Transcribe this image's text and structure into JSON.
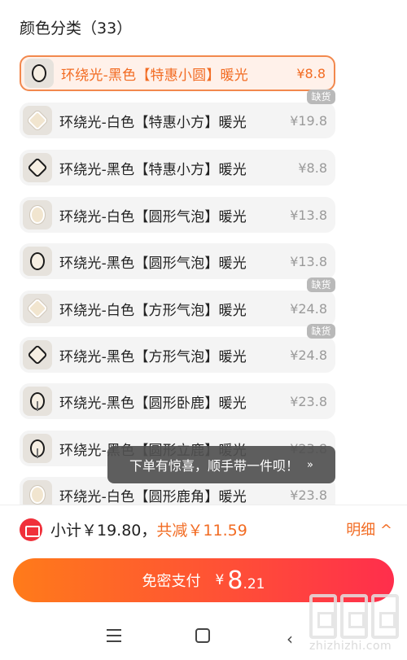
{
  "section": {
    "title": "颜色分类（33）"
  },
  "options": [
    {
      "label": "环绕光-黑色【特惠小圆】暖光",
      "price": "¥8.8",
      "badge": "",
      "selected": true
    },
    {
      "label": "环绕光-白色【特惠小方】暖光",
      "price": "¥19.8",
      "badge": "缺货",
      "selected": false
    },
    {
      "label": "环绕光-黑色【特惠小方】暖光",
      "price": "¥8.8",
      "badge": "",
      "selected": false
    },
    {
      "label": "环绕光-白色【圆形气泡】暖光",
      "price": "¥13.8",
      "badge": "",
      "selected": false
    },
    {
      "label": "环绕光-黑色【圆形气泡】暖光",
      "price": "¥13.8",
      "badge": "",
      "selected": false
    },
    {
      "label": "环绕光-白色【方形气泡】暖光",
      "price": "¥24.8",
      "badge": "缺货",
      "selected": false
    },
    {
      "label": "环绕光-黑色【方形气泡】暖光",
      "price": "¥24.8",
      "badge": "缺货",
      "selected": false
    },
    {
      "label": "环绕光-黑色【圆形卧鹿】暖光",
      "price": "¥23.8",
      "badge": "",
      "selected": false
    },
    {
      "label": "环绕光-黑色【圆形立鹿】暖光",
      "price": "¥23.8",
      "badge": "",
      "selected": false
    },
    {
      "label": "环绕光-白色【圆形鹿角】暖光",
      "price": "¥23.8",
      "badge": "",
      "selected": false
    }
  ],
  "toast": {
    "text": "下单有惊喜，顺手带一件呗！",
    "chevron": "»"
  },
  "summary": {
    "subtotal": "小计￥19.80，",
    "reduction": "共减￥11.59",
    "detail": "明细 ^"
  },
  "pay": {
    "label": "免密支付",
    "currency": "¥",
    "integer": "8",
    "decimal": ".21"
  },
  "watermark": {
    "text": "zhizhizhi.com"
  },
  "colors": {
    "accent": "#f26b22",
    "pay_start": "#ff7b1a",
    "pay_end": "#ff2e4c"
  }
}
